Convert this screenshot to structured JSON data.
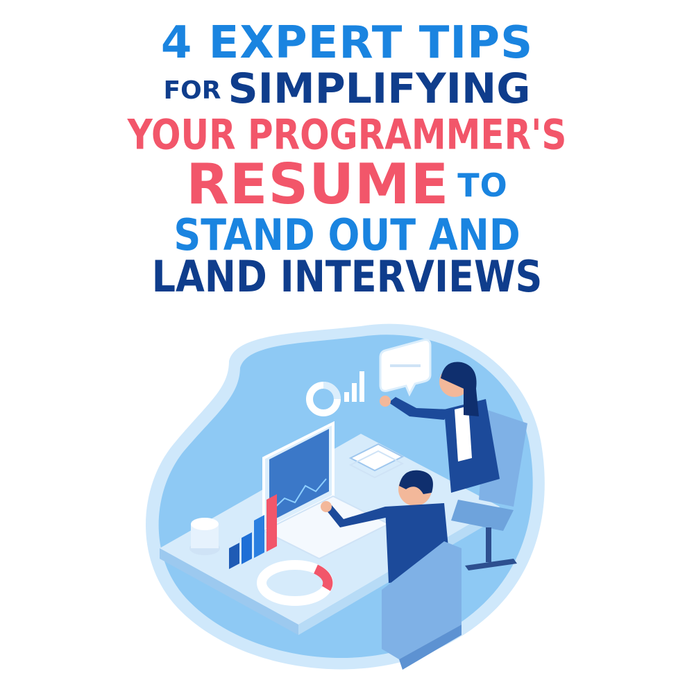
{
  "headline": {
    "line1": "4 EXPERT TIPS",
    "line2_small": "FOR",
    "line2": "SIMPLIFYING",
    "line3": "YOUR PROGRAMMER'S",
    "line4": "RESUME",
    "line4_small": "TO",
    "line5": "STAND OUT AND",
    "line6": "LAND INTERVIEWS"
  },
  "colors": {
    "light_blue": "#1a84e0",
    "dark_blue": "#0f3d8c",
    "coral": "#f2566a",
    "blob": "#8ec9f4",
    "blob_rim": "#cfe8fb"
  },
  "illustration": {
    "icons": [
      "donut-chart-icon",
      "bar-chart-icon",
      "speech-bubble-icon"
    ],
    "scene": "business-meeting-at-desk"
  }
}
